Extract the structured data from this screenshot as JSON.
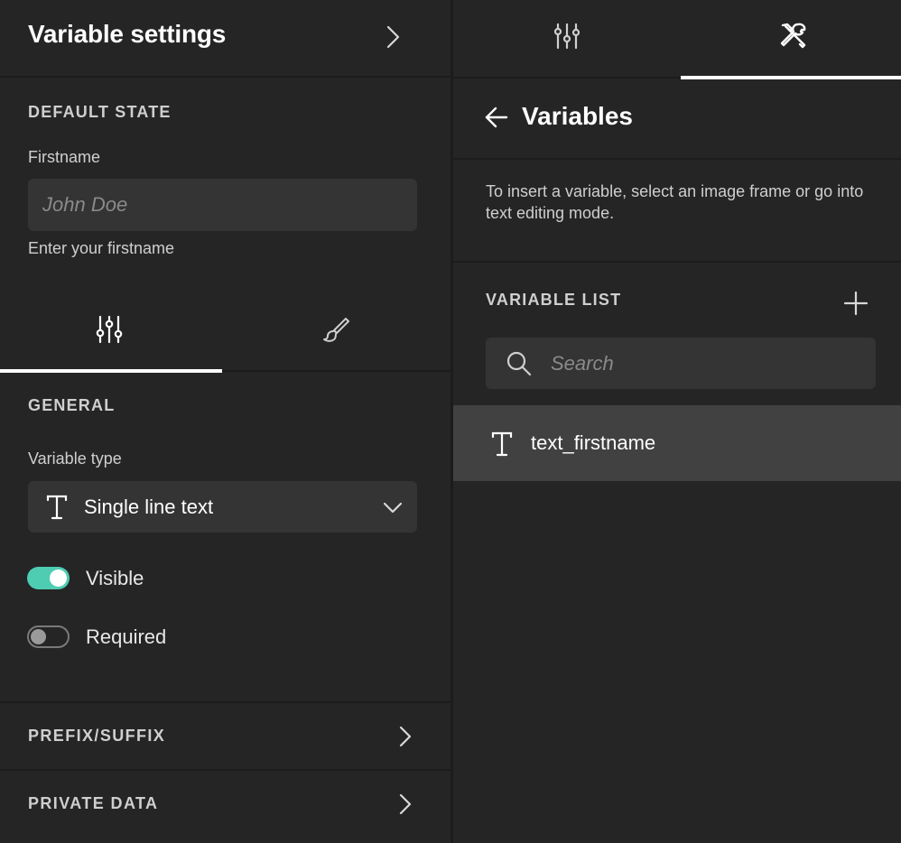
{
  "left_panel": {
    "title": "Variable settings",
    "default_state": {
      "section_title": "DEFAULT STATE",
      "field_label": "Firstname",
      "field_placeholder": "John Doe",
      "field_value": "",
      "helper_text": "Enter your firstname"
    },
    "inner_tabs": [
      {
        "icon": "sliders-icon",
        "active": true
      },
      {
        "icon": "paintbrush-icon",
        "active": false
      }
    ],
    "general": {
      "section_title": "GENERAL",
      "variable_type_label": "Variable type",
      "variable_type_value": "Single line text",
      "variable_type_icon": "text-type-icon"
    },
    "toggles": {
      "visible": {
        "label": "Visible",
        "on": true
      },
      "required": {
        "label": "Required",
        "on": false
      }
    },
    "collapsibles": {
      "prefix_suffix": "PREFIX/SUFFIX",
      "private_data": "PRIVATE DATA"
    }
  },
  "right_panel": {
    "tabs": [
      {
        "icon": "sliders-icon",
        "active": false
      },
      {
        "icon": "tools-icon",
        "active": true
      }
    ],
    "title": "Variables",
    "hint": "To insert a variable, select an image frame or go into text editing mode.",
    "variable_list": {
      "section_title": "VARIABLE LIST",
      "search_placeholder": "Search",
      "items": [
        {
          "name": "text_firstname",
          "icon": "text-type-icon",
          "selected": true
        }
      ]
    }
  },
  "colors": {
    "background": "#252525",
    "input_background": "#343434",
    "selected_row": "#414141",
    "accent": "#4ecdb3",
    "divider": "#1c1c1c"
  }
}
